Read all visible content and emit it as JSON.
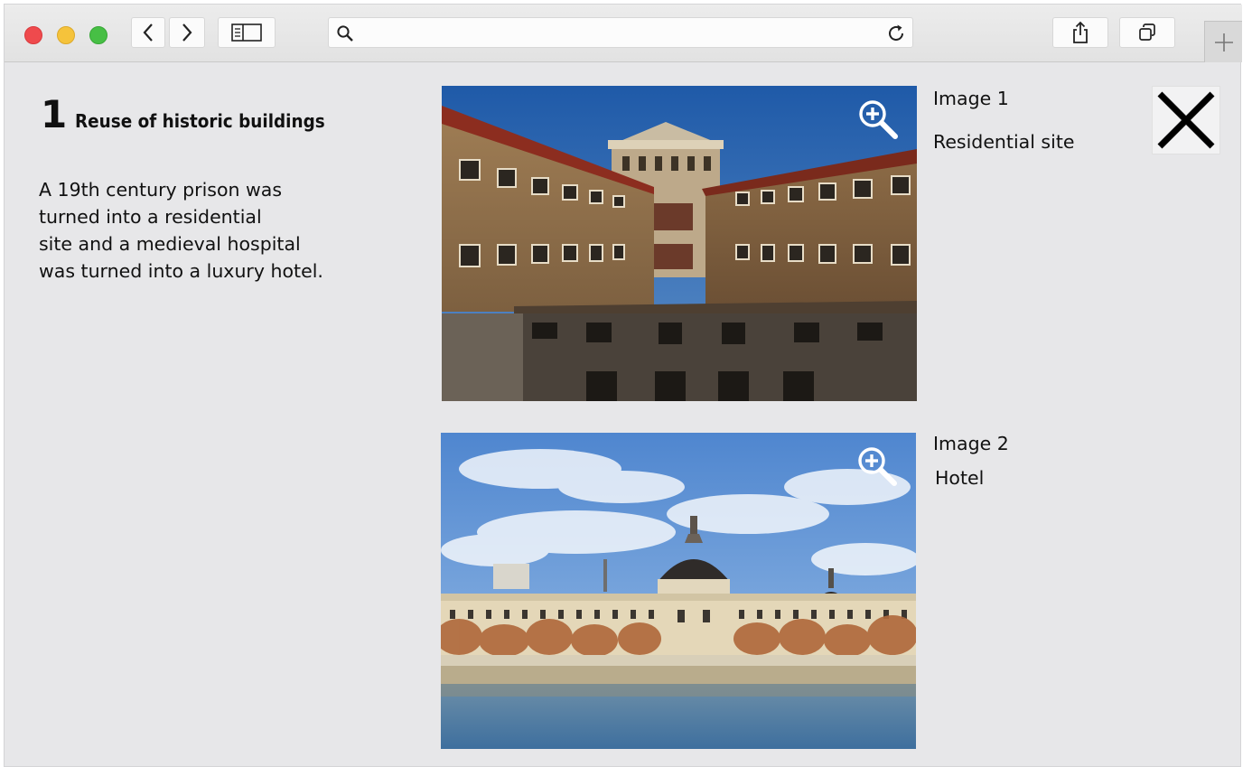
{
  "browser": {
    "address_placeholder": "",
    "buttons": {
      "back": "back-arrow-icon",
      "forward": "forward-arrow-icon",
      "sidebar": "sidebar-icon",
      "search": "search-icon",
      "reload": "reload-icon",
      "share": "share-icon",
      "tabs": "tabs-icon",
      "new_tab": "plus-icon"
    },
    "colors": {
      "close": "#ef4a4d",
      "minimize": "#f5c33b",
      "maximize": "#47bf45"
    }
  },
  "page": {
    "number": "1",
    "title": "Reuse of historic buildings",
    "description_lines": [
      "A 19th century prison was",
      "turned into a residential",
      "site and a medieval hospital",
      "was turned into a luxury hotel."
    ]
  },
  "images": [
    {
      "label": "Image 1",
      "caption": "Residential site",
      "zoom_icon": "zoom-in-icon"
    },
    {
      "label": "Image 2",
      "caption": "Hotel",
      "zoom_icon": "zoom-in-icon"
    }
  ],
  "close_icon": "close-x-icon"
}
